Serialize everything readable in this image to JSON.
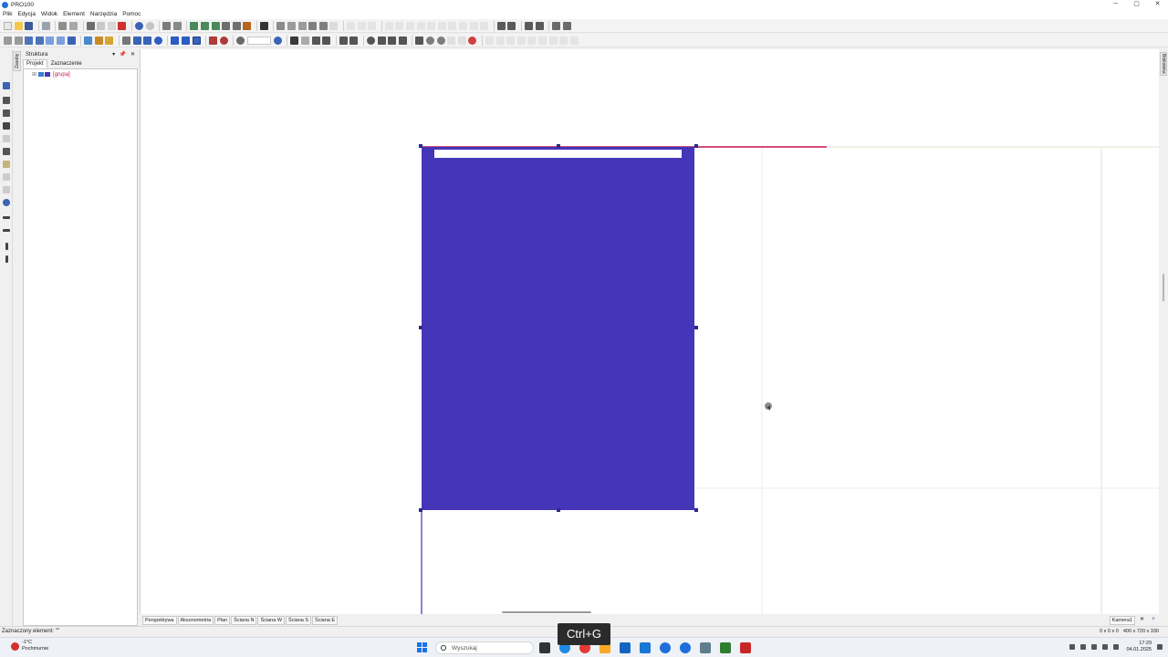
{
  "window": {
    "title": "PRO100",
    "controls": [
      "─",
      "▢",
      "✕"
    ]
  },
  "menu": [
    "Plik",
    "Edycja",
    "Widok",
    "Element",
    "Narzędzia",
    "Pomoc"
  ],
  "left_panel": {
    "side_tab": "Zasoby",
    "title": "Struktura",
    "title_buttons": [
      "▾",
      "📌",
      "✕"
    ],
    "tabs": [
      "Projekt",
      "Zaznaczenie"
    ],
    "tree": [
      {
        "expander": "⊞",
        "label": "[grupa]"
      }
    ]
  },
  "right_panel": {
    "side_tab": "Biblioteka"
  },
  "view_tabs": [
    "Perspektywa",
    "Aksonometria",
    "Plan",
    "Ściana N",
    "Ściana W",
    "Ściana S",
    "Ściana E"
  ],
  "camera": {
    "label": "Kamera1",
    "close": "✕",
    "add": "+"
  },
  "status": {
    "selected": "Zaznaczony element: \"\"",
    "position": "0 x 0 x 0",
    "size": "400 x 720 x 330"
  },
  "keystroke_overlay": "Ctrl+G",
  "taskbar": {
    "weather_temp": "-1°C",
    "weather_desc": "Pochmurnie",
    "search_placeholder": "Wyszukaj",
    "time": "17:29",
    "date": "04.01.2025"
  },
  "colors": {
    "panel_fill": "#4535b8",
    "selection_handle": "#2a2a8a",
    "top_edge_line": "#c0134a",
    "accent": "#1a73e8"
  }
}
